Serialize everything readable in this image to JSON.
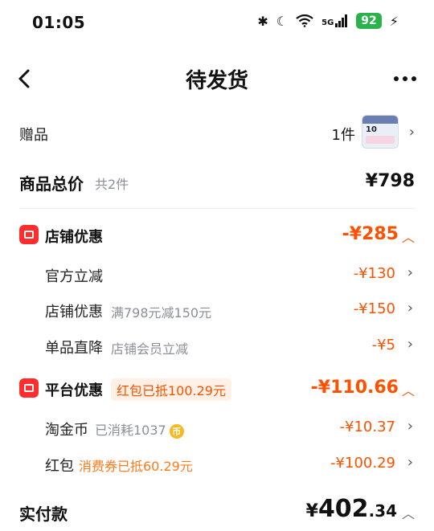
{
  "status_bar": {
    "time": "01:05",
    "network": "5G",
    "battery": "92"
  },
  "header": {
    "title": "待发货"
  },
  "gift": {
    "label": "赠品",
    "count": "1件",
    "thumb_number": "10"
  },
  "total": {
    "label": "商品总价",
    "count": "共2件",
    "price": "¥798"
  },
  "store_discount": {
    "label": "店铺优惠",
    "amount": "-¥285",
    "items": [
      {
        "label": "官方立减",
        "detail": "",
        "amount": "-¥130"
      },
      {
        "label": "店铺优惠",
        "detail": "满798元减150元",
        "amount": "-¥150"
      },
      {
        "label": "单品直降",
        "detail": "店铺会员立减",
        "amount": "-¥5"
      }
    ]
  },
  "platform_discount": {
    "label": "平台优惠",
    "tag": "红包已抵100.29元",
    "amount": "-¥110.66",
    "items": [
      {
        "label": "淘金币",
        "detail": "已消耗1037",
        "coin": "币",
        "amount": "-¥10.37"
      },
      {
        "label": "红包",
        "detail": "消费券已抵60.29元",
        "amount": "-¥100.29"
      }
    ]
  },
  "paid": {
    "label": "实付款",
    "currency": "¥",
    "integer": "402",
    "decimal": ".34"
  },
  "colors": {
    "accent": "#ff5000",
    "section_icon": "#ff2d2d",
    "battery": "#2bb24c"
  }
}
